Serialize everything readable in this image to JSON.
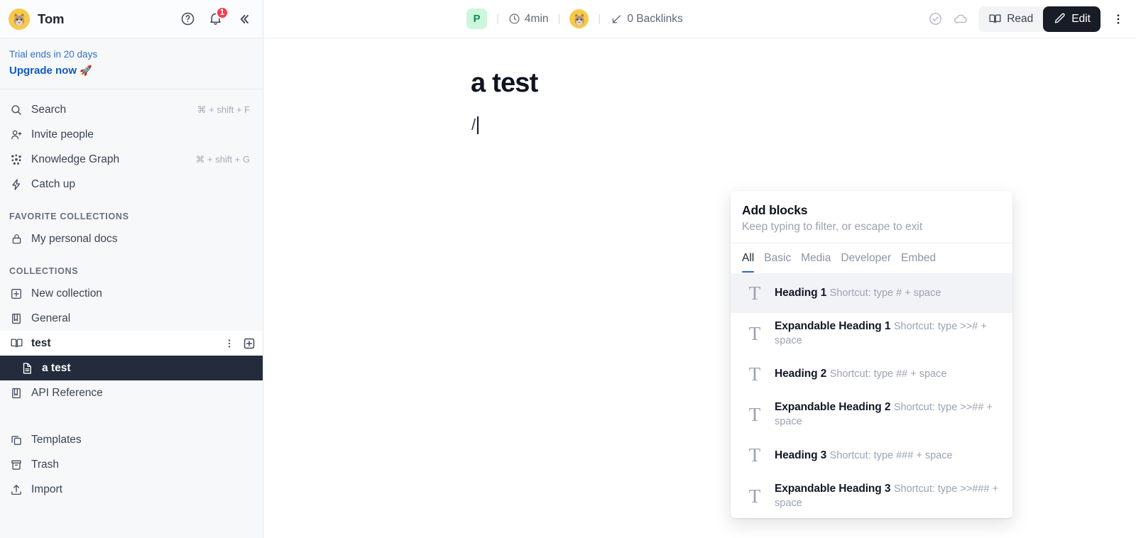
{
  "sidebar": {
    "user": {
      "name": "Tom",
      "avatar_icon": "cat-avatar",
      "avatar_glyph": "🐱"
    },
    "header_actions": [
      {
        "name": "help-icon",
        "label": "Help"
      },
      {
        "name": "notifications-icon",
        "label": "Notifications",
        "badge": "1"
      },
      {
        "name": "collapse-sidebar-icon",
        "label": "Collapse sidebar"
      }
    ],
    "trial": {
      "status": "Trial ends in 20 days",
      "cta": "Upgrade now",
      "cta_emoji": "🚀"
    },
    "nav": [
      {
        "label": "Search",
        "icon": "search-icon",
        "shortcut": "⌘ + shift + F"
      },
      {
        "label": "Invite people",
        "icon": "invite-people-icon",
        "shortcut": ""
      },
      {
        "label": "Knowledge Graph",
        "icon": "knowledge-graph-icon",
        "shortcut": "⌘ + shift + G"
      },
      {
        "label": "Catch up",
        "icon": "catch-up-icon",
        "shortcut": ""
      }
    ],
    "favorites_heading": "FAVORITE COLLECTIONS",
    "favorites": [
      {
        "label": "My personal docs",
        "icon": "lock-icon"
      }
    ],
    "collections_heading": "COLLECTIONS",
    "collections": [
      {
        "label": "New collection",
        "icon": "plus-square-icon"
      },
      {
        "label": "General",
        "icon": "book-closed-icon"
      }
    ],
    "open_collection": {
      "label": "test",
      "icon": "book-open-icon",
      "menu_icon": "kebab-menu-icon",
      "add_icon": "plus-square-icon",
      "children": [
        {
          "label": "a test",
          "icon": "document-icon",
          "selected": true
        }
      ]
    },
    "collections_after": [
      {
        "label": "API Reference",
        "icon": "book-closed-icon"
      }
    ],
    "footer": [
      {
        "label": "Templates",
        "icon": "templates-icon"
      },
      {
        "label": "Trash",
        "icon": "trash-icon"
      },
      {
        "label": "Import",
        "icon": "import-icon"
      }
    ]
  },
  "topbar": {
    "badge_letter": "P",
    "read_time": "4min",
    "read_time_icon": "clock-icon",
    "collaborator_avatar": "cat-avatar",
    "backlinks": "0 Backlinks",
    "backlinks_icon": "backlink-arrow-icon",
    "status_icons": [
      {
        "name": "check-circle-icon"
      },
      {
        "name": "cloud-icon"
      }
    ],
    "read_label": "Read",
    "read_icon": "book-open-icon",
    "edit_label": "Edit",
    "edit_icon": "pencil-icon",
    "more_icon": "kebab-menu-icon"
  },
  "document": {
    "title": "a test",
    "body_text": "/"
  },
  "popup": {
    "title": "Add blocks",
    "subtitle": "Keep typing to filter, or escape to exit",
    "tabs": [
      {
        "label": "All",
        "active": true
      },
      {
        "label": "Basic",
        "active": false
      },
      {
        "label": "Media",
        "active": false
      },
      {
        "label": "Developer",
        "active": false
      },
      {
        "label": "Embed",
        "active": false
      }
    ],
    "blocks": [
      {
        "name": "Heading 1",
        "shortcut": "Shortcut: type # + space",
        "icon": "text-T-icon",
        "selected": true
      },
      {
        "name": "Expandable Heading 1",
        "shortcut": "Shortcut: type >># + space",
        "icon": "text-T-icon",
        "selected": false
      },
      {
        "name": "Heading 2",
        "shortcut": "Shortcut: type ## + space",
        "icon": "text-T-icon",
        "selected": false
      },
      {
        "name": "Expandable Heading 2",
        "shortcut": "Shortcut: type >>## + space",
        "icon": "text-T-icon",
        "selected": false
      },
      {
        "name": "Heading 3",
        "shortcut": "Shortcut: type ### + space",
        "icon": "text-T-icon",
        "selected": false
      },
      {
        "name": "Expandable Heading 3",
        "shortcut": "Shortcut: type >>### + space",
        "icon": "text-T-icon",
        "selected": false
      }
    ]
  },
  "colors": {
    "accent_blue": "#2563cf",
    "link_blue": "#1059c8",
    "selected_dark": "#232c3d",
    "badge_red": "#fb3b4e",
    "green_badge_bg": "#cdf7dd",
    "green_badge_fg": "#11864f"
  }
}
